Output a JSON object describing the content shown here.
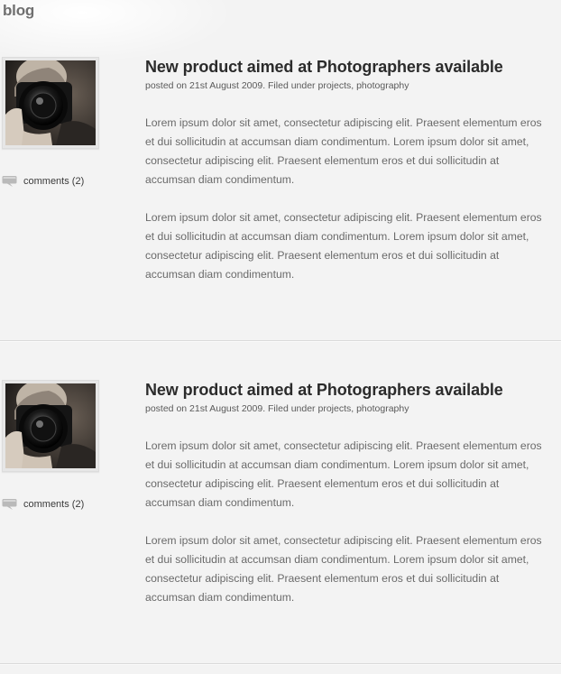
{
  "section": {
    "title": "blog"
  },
  "posts": [
    {
      "title": "New product aimed at Photographers available",
      "meta_prefix": "posted on 21st August 2009. Filed under ",
      "category_1": "projects",
      "category_sep": ", ",
      "category_2": "photography",
      "paragraphs": [
        "Lorem ipsum dolor sit amet, consectetur adipiscing elit. Praesent elementum eros et dui sollicitudin at accumsan diam condimentum. Lorem ipsum dolor sit amet, consectetur adipiscing elit. Praesent elementum eros et dui sollicitudin at accumsan diam condimentum.",
        "Lorem ipsum dolor sit amet, consectetur adipiscing elit. Praesent elementum eros et dui sollicitudin at accumsan diam condimentum. Lorem ipsum dolor sit amet, consectetur adipiscing elit. Praesent elementum eros et dui sollicitudin at accumsan diam condimentum."
      ],
      "comments_label": "comments (2)",
      "thumbnail_icon": "photographer-camera-photo",
      "comment_icon": "speech-bubble-icon"
    },
    {
      "title": "New product aimed at Photographers available",
      "meta_prefix": "posted on 21st August 2009. Filed under ",
      "category_1": "projects",
      "category_sep": ", ",
      "category_2": "photography",
      "paragraphs": [
        "Lorem ipsum dolor sit amet, consectetur adipiscing elit. Praesent elementum eros et dui sollicitudin at accumsan diam condimentum. Lorem ipsum dolor sit amet, consectetur adipiscing elit. Praesent elementum eros et dui sollicitudin at accumsan diam condimentum.",
        "Lorem ipsum dolor sit amet, consectetur adipiscing elit. Praesent elementum eros et dui sollicitudin at accumsan diam condimentum. Lorem ipsum dolor sit amet, consectetur adipiscing elit. Praesent elementum eros et dui sollicitudin at accumsan diam condimentum."
      ],
      "comments_label": "comments (2)",
      "thumbnail_icon": "photographer-camera-photo",
      "comment_icon": "speech-bubble-icon"
    }
  ],
  "colors": {
    "background": "#f3f3f3",
    "title_text": "#2b2b2b",
    "body_text": "#6a6a6a",
    "divider": "#dadada"
  }
}
